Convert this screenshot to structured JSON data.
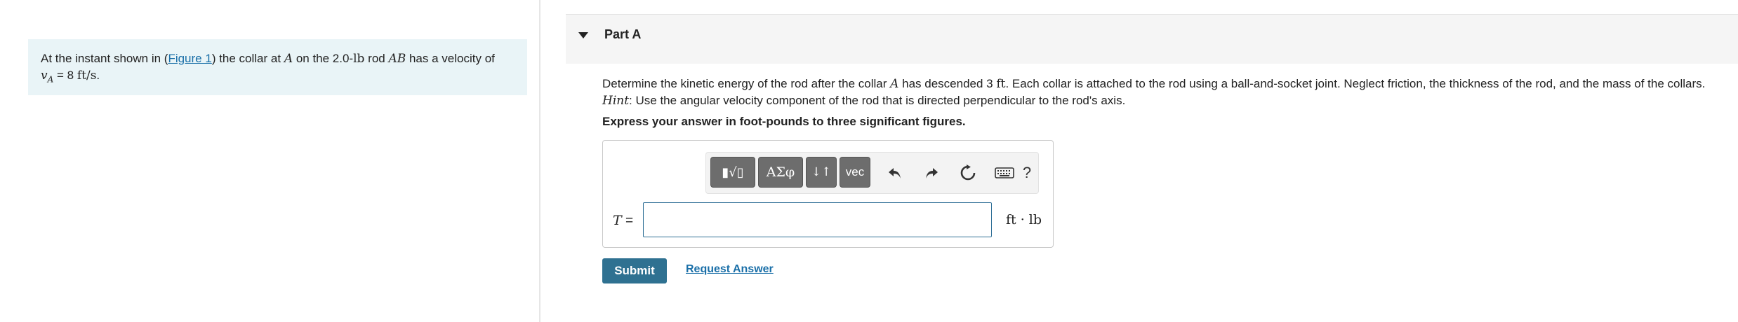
{
  "intro": {
    "pre": "At the instant shown in (",
    "figure_link": "Figure 1",
    "mid1": ") the collar at ",
    "var_a": "A",
    "mid2": " on the 2.0-",
    "unit_lb": "lb",
    "mid3": " rod ",
    "var_ab": "AB",
    "mid4": " has a velocity of",
    "velocity_symbol": "v",
    "velocity_sub": "A",
    "velocity_eq": " = 8 ",
    "velocity_unit": "ft/s",
    "velocity_end": "."
  },
  "part": {
    "title": "Part A"
  },
  "question": {
    "line1_pre": "Determine the kinetic energy of the rod after the collar ",
    "line1_var": "A",
    "line1_mid": " has descended 3 ",
    "line1_unit": "ft",
    "line1_post": ". Each collar is attached to the rod using a ball-and-socket joint. Neglect friction, the thickness of the rod, and the mass of the collars.",
    "hint_label": "Hint",
    "hint_text": ": Use the angular velocity component of the rod that is directed perpendicular to the rod's axis.",
    "instruction": "Express your answer in foot-pounds to three significant figures."
  },
  "toolbar": {
    "template_label": "▮√▯",
    "greek_label": "ΑΣφ",
    "arrows_label": "↓↑",
    "vec_label": "vec",
    "help_label": "?",
    "icons": [
      "templates-icon",
      "greek-symbols-icon",
      "arrows-icon",
      "vector-icon",
      "undo-icon",
      "redo-icon",
      "reset-icon",
      "keyboard-icon",
      "help-icon"
    ]
  },
  "answer": {
    "variable": "T",
    "equals": " =",
    "value": "",
    "units": "ft · lb"
  },
  "actions": {
    "submit_label": "Submit",
    "request_label": "Request Answer"
  },
  "colors": {
    "intro_bg": "#e9f4f7",
    "link": "#1a6fa8",
    "submit_bg": "#2f7191",
    "input_border": "#2f6f96",
    "toolbar_button": "#6d6d6d"
  }
}
